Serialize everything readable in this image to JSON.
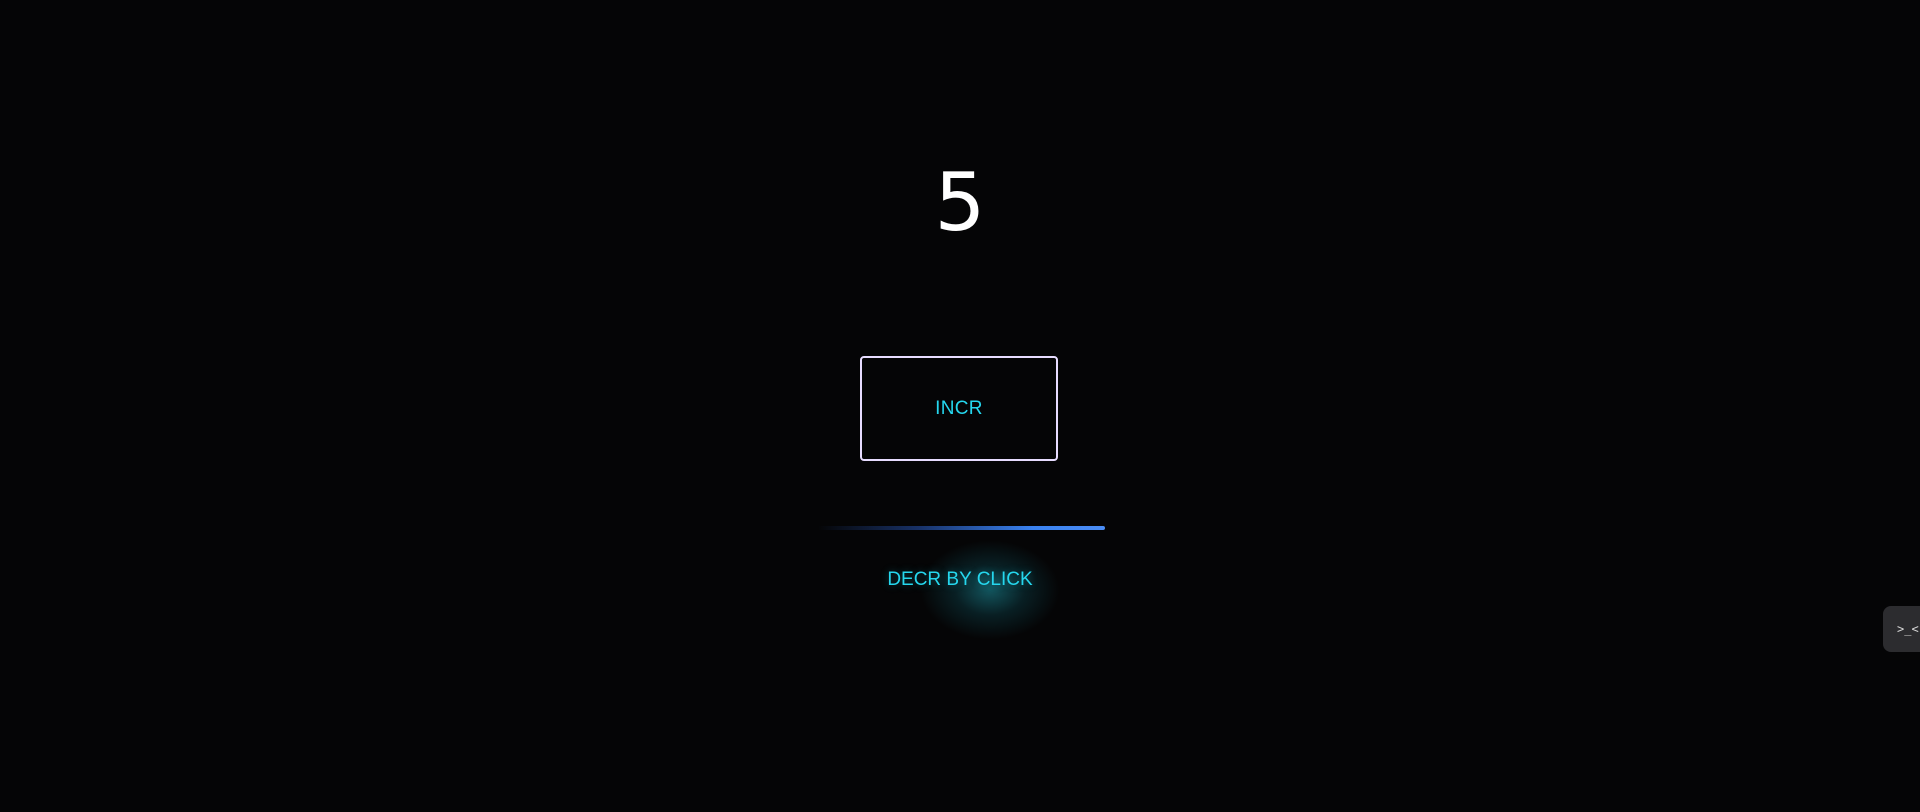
{
  "counter": {
    "value": "5"
  },
  "buttons": {
    "incr_label": "INCR",
    "decr_label": "DECR BY CLICK"
  },
  "side_tab": {
    "glyph": ">_<"
  },
  "colors": {
    "background": "#050506",
    "accent_text": "#25d7ee",
    "button_border": "#e7dcff",
    "progress_line": "#3a82f0"
  }
}
